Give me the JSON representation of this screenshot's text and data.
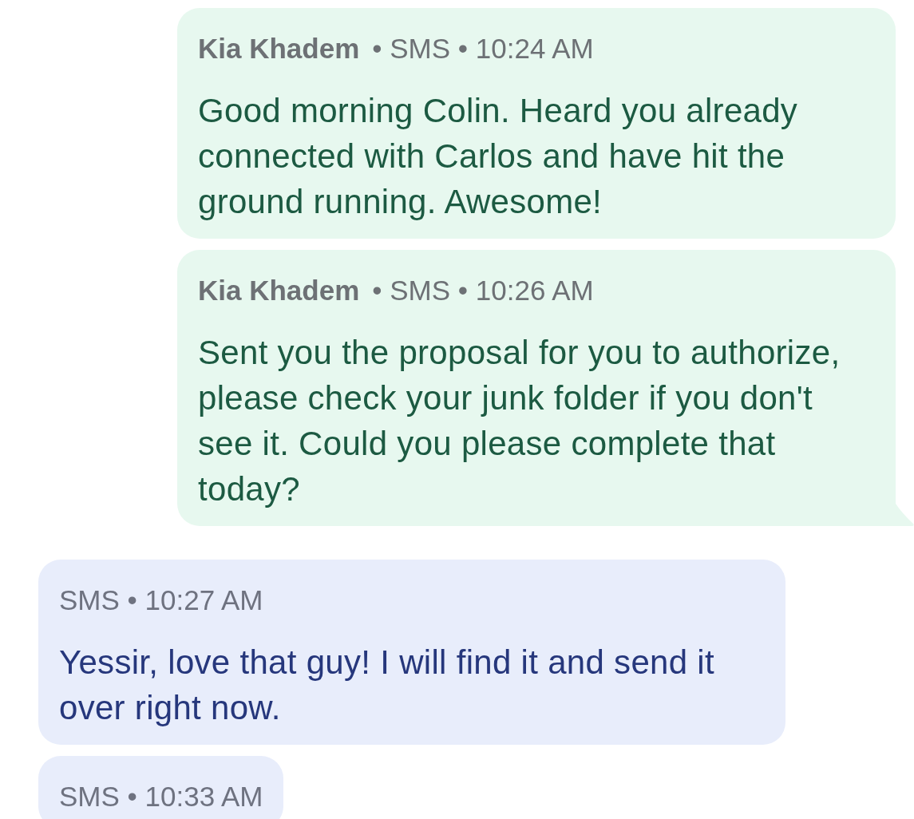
{
  "messages": [
    {
      "kind": "outgoing",
      "sender": "Kia Khadem",
      "meta": "• SMS • 10:24 AM",
      "text": "Good morning Colin. Heard you already connected with Carlos and have hit the ground running. Awesome!",
      "tail": false
    },
    {
      "kind": "outgoing",
      "sender": "Kia Khadem",
      "meta": "• SMS • 10:26 AM",
      "text": "Sent you the proposal for you to authorize, please check your junk folder if you don't see it. Could you please complete that today?",
      "tail": true
    },
    {
      "kind": "incoming",
      "meta": "SMS • 10:27 AM",
      "text": "Yessir, love that guy! I will find it and send it over right now.",
      "tail": false
    },
    {
      "kind": "incoming",
      "meta": "SMS • 10:33 AM",
      "tail": false
    }
  ]
}
